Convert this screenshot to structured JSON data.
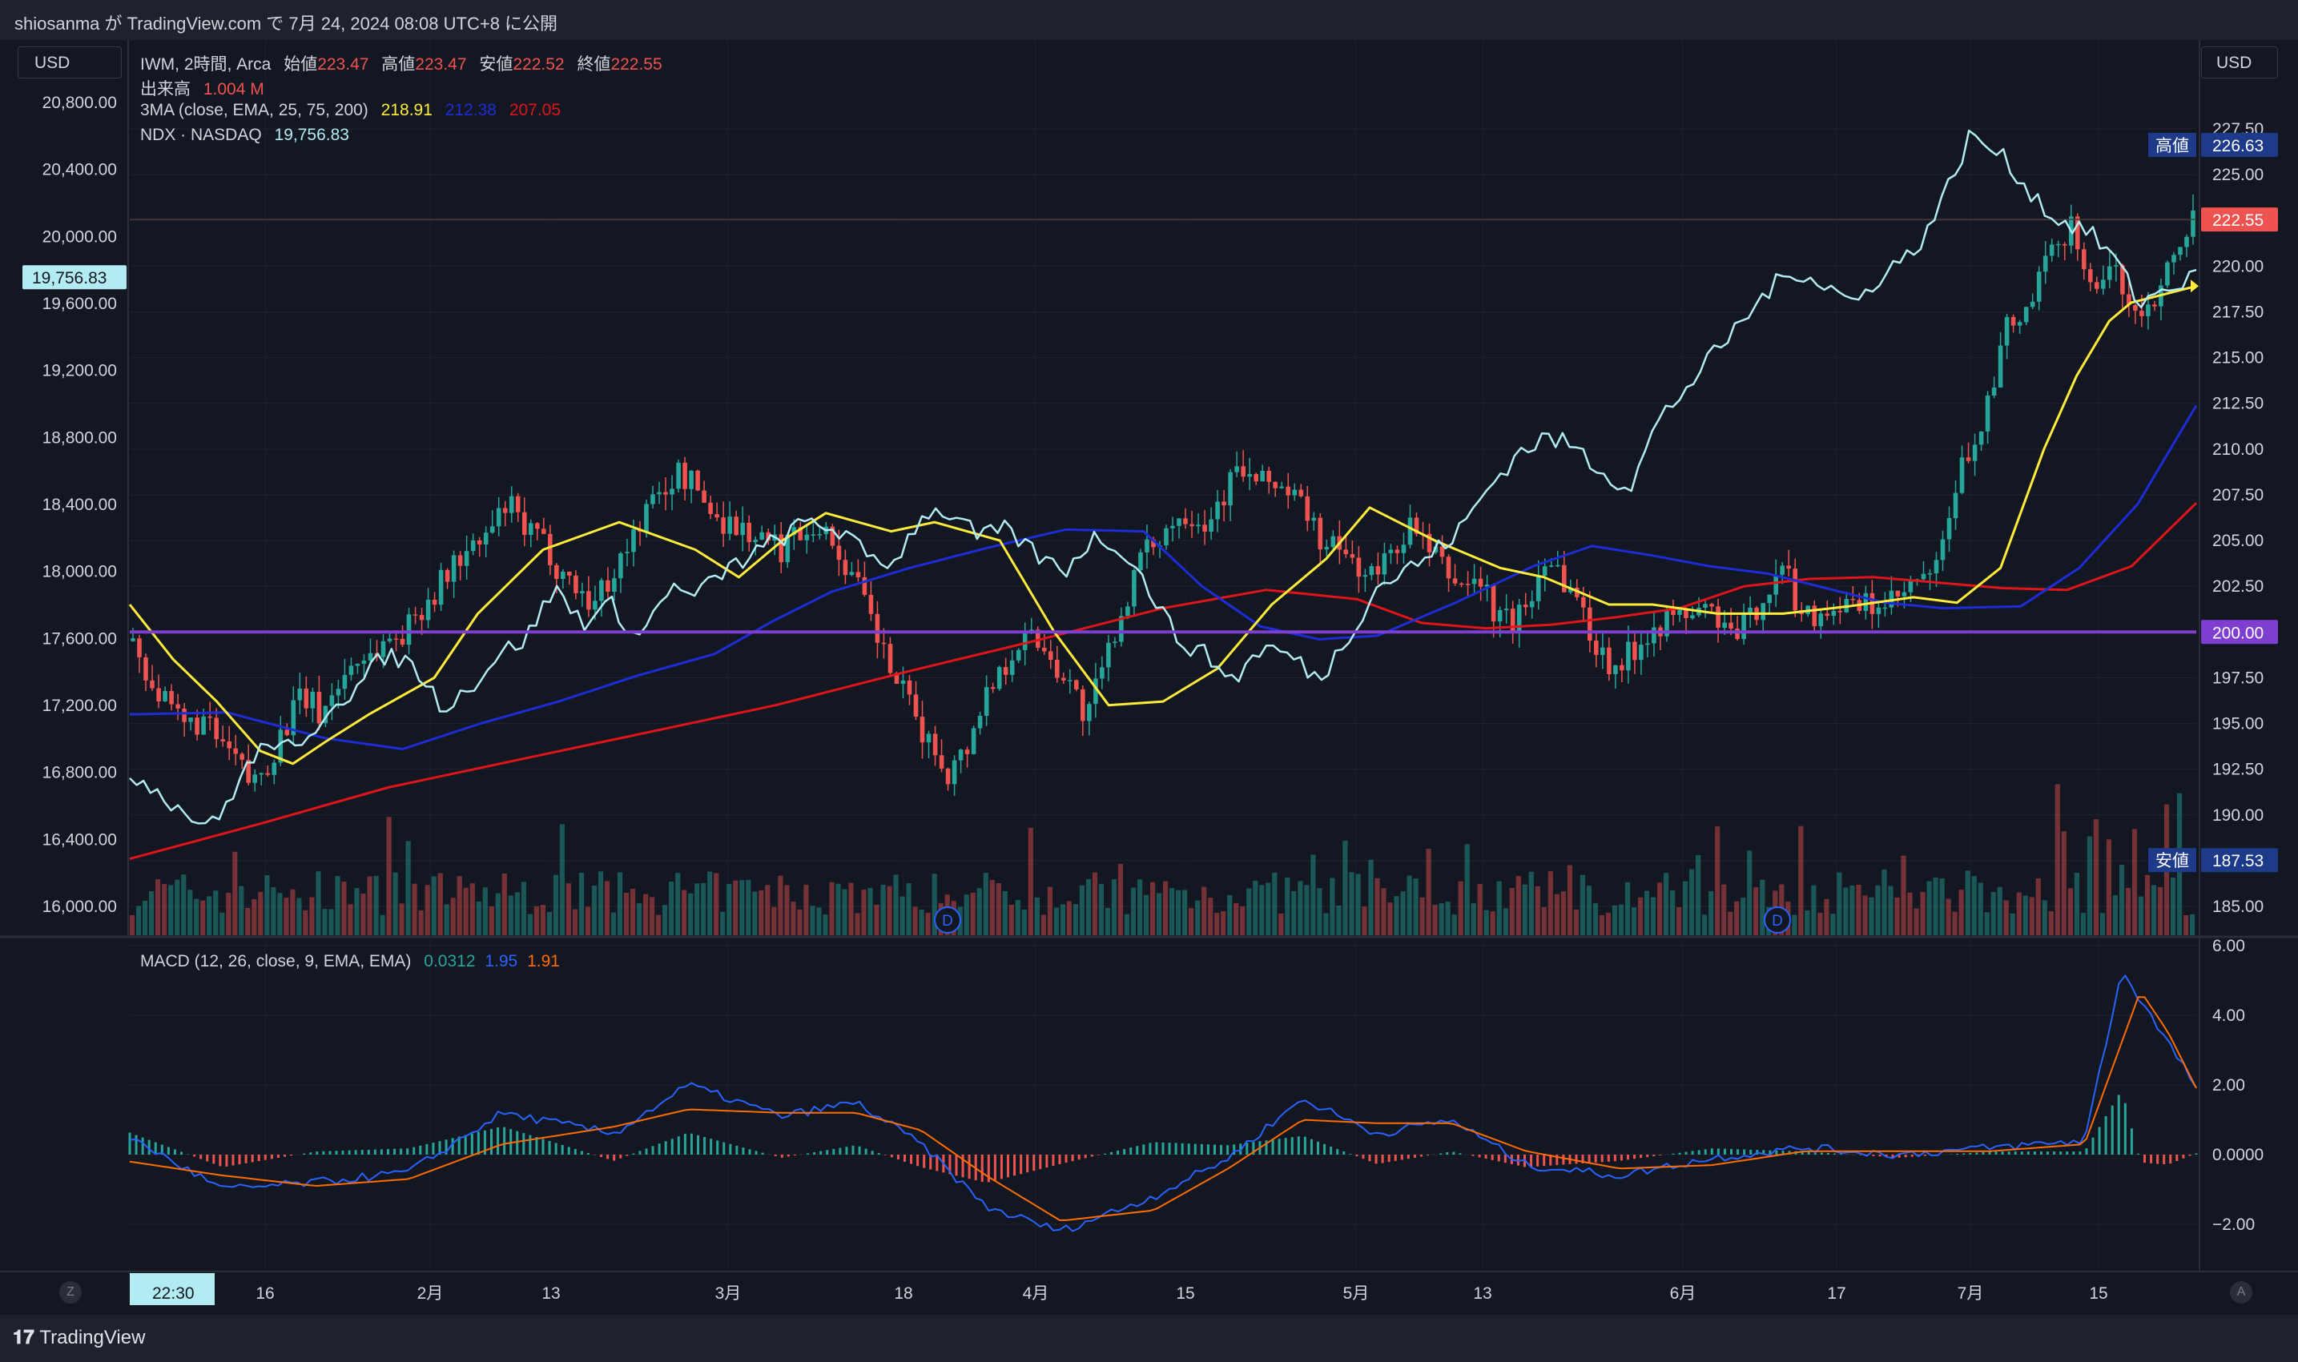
{
  "published": "shiosanma が TradingView.com で 7月 24, 2024 08:08 UTC+8 に公開",
  "currency_left": "USD",
  "currency_right": "USD",
  "legend": {
    "symbol": "IWM, 2時間, Arca",
    "open_label": "始値",
    "open": "223.47",
    "high_label": "高値",
    "high": "223.47",
    "low_label": "安値",
    "low": "222.52",
    "close_label": "終値",
    "close": "222.55",
    "volume_label": "出来高",
    "volume": "1.004 M",
    "ma_label": "3MA (close, EMA, 25, 75, 200)",
    "ma25": "218.91",
    "ma75": "212.38",
    "ma200": "207.05",
    "ndx_label": "NDX · NASDAQ",
    "ndx_value": "19,756.83",
    "macd_label": "MACD (12, 26, close, 9, EMA, EMA)",
    "macd_hist": "0.0312",
    "macd_line": "1.95",
    "macd_signal": "1.91"
  },
  "right_axis": [
    "227.50",
    "225.00",
    "222.50",
    "220.00",
    "217.50",
    "215.00",
    "212.50",
    "210.00",
    "207.50",
    "205.00",
    "202.50",
    "200.00",
    "197.50",
    "195.00",
    "192.50",
    "190.00",
    "187.50",
    "185.00"
  ],
  "left_axis": [
    "20,800.00",
    "20,400.00",
    "20,000.00",
    "19,600.00",
    "19,200.00",
    "18,800.00",
    "18,400.00",
    "18,000.00",
    "17,600.00",
    "17,200.00",
    "16,800.00",
    "16,400.00",
    "16,000.00"
  ],
  "macd_axis": [
    "6.00",
    "4.00",
    "2.00",
    "0.0000",
    "−2.00"
  ],
  "time_axis": [
    "16",
    "2月",
    "13",
    "3月",
    "18",
    "4月",
    "15",
    "5月",
    "13",
    "6月",
    "17",
    "7月",
    "15"
  ],
  "time_cursor": "22:30",
  "price_tags": {
    "high_label": "高値",
    "high_value": "226.63",
    "last": "222.55",
    "level": "200.00",
    "low_label": "安値",
    "low_value": "187.53",
    "ndx_tag": "19,756.83"
  },
  "dividend_marker": "D",
  "corner_left": "Z",
  "corner_right": "A",
  "logo": "TradingView",
  "colors": {
    "background": "#131722",
    "up": "#26a69a",
    "down": "#ef5350",
    "ma25": "#ffeb3b",
    "ma75": "#1e2cd8",
    "ma200": "#e0151b",
    "ndx": "#b2ebf2",
    "level": "#7e3fd1",
    "macd": "#2962ff",
    "signal": "#ff6d00"
  },
  "chart_data": {
    "type": "candlestick",
    "timeframe": "2H",
    "x_ticks": [
      "16",
      "2月",
      "13",
      "3月",
      "18",
      "4月",
      "15",
      "5月",
      "13",
      "6月",
      "17",
      "7月",
      "15"
    ],
    "price_ylim": [
      185.0,
      227.5
    ],
    "ndx_ylim": [
      16000,
      20800
    ],
    "macd_ylim": [
      -2.0,
      6.0
    ],
    "iwm_close_path": [
      [
        0,
        199.5
      ],
      [
        1,
        197.5
      ],
      [
        2,
        195.8
      ],
      [
        3,
        194.8
      ],
      [
        4,
        195.2
      ],
      [
        5,
        194.0
      ],
      [
        6,
        193.0
      ],
      [
        7,
        191.6
      ],
      [
        8,
        193.0
      ],
      [
        9,
        195.0
      ],
      [
        10,
        196.5
      ],
      [
        11,
        195.5
      ],
      [
        12,
        197.0
      ],
      [
        13,
        198.5
      ],
      [
        14,
        198.8
      ],
      [
        15,
        199.6
      ],
      [
        16,
        200.0
      ],
      [
        17,
        201.5
      ],
      [
        18,
        202.5
      ],
      [
        19,
        204.0
      ],
      [
        20,
        204.4
      ],
      [
        21,
        205.5
      ],
      [
        22,
        207.0
      ],
      [
        23,
        205.5
      ],
      [
        24,
        205.0
      ],
      [
        25,
        203.5
      ],
      [
        26,
        202.5
      ],
      [
        27,
        201.5
      ],
      [
        28,
        203.0
      ],
      [
        29,
        204.5
      ],
      [
        30,
        206.5
      ],
      [
        31,
        207.5
      ],
      [
        32,
        208.7
      ],
      [
        33,
        208.0
      ],
      [
        34,
        206.5
      ],
      [
        35,
        206.0
      ],
      [
        36,
        205.5
      ],
      [
        37,
        205.0
      ],
      [
        38,
        204.5
      ],
      [
        39,
        205.5
      ],
      [
        40,
        206.0
      ],
      [
        41,
        205.0
      ],
      [
        42,
        203.5
      ],
      [
        43,
        201.5
      ],
      [
        44,
        199.0
      ],
      [
        45,
        197.0
      ],
      [
        46,
        195.2
      ],
      [
        47,
        193.5
      ],
      [
        48,
        192.3
      ],
      [
        49,
        193.8
      ],
      [
        50,
        196.5
      ],
      [
        51,
        198.0
      ],
      [
        52,
        199.5
      ],
      [
        53,
        199.8
      ],
      [
        54,
        198.5
      ],
      [
        55,
        197.3
      ],
      [
        56,
        195.2
      ],
      [
        57,
        198.0
      ],
      [
        58,
        201.0
      ],
      [
        59,
        203.5
      ],
      [
        60,
        205.0
      ],
      [
        61,
        206.0
      ],
      [
        62,
        206.7
      ],
      [
        63,
        206.0
      ],
      [
        64,
        207.5
      ],
      [
        65,
        209.0
      ],
      [
        66,
        208.0
      ],
      [
        67,
        208.3
      ],
      [
        68,
        207.5
      ],
      [
        69,
        206.5
      ],
      [
        70,
        204.5
      ],
      [
        71,
        204.5
      ],
      [
        72,
        203.5
      ],
      [
        73,
        203.0
      ],
      [
        74,
        204.5
      ],
      [
        75,
        205.8
      ],
      [
        76,
        204.5
      ],
      [
        77,
        203.5
      ],
      [
        78,
        202.5
      ],
      [
        79,
        203.0
      ],
      [
        80,
        201.0
      ],
      [
        81,
        200.5
      ],
      [
        82,
        201.5
      ],
      [
        83,
        204.5
      ],
      [
        84,
        203.0
      ],
      [
        85,
        201.5
      ],
      [
        86,
        199.0
      ],
      [
        87,
        198.2
      ],
      [
        88,
        198.8
      ],
      [
        89,
        200.2
      ],
      [
        90,
        200.6
      ],
      [
        91,
        200.8
      ],
      [
        92,
        201.3
      ],
      [
        93,
        200.9
      ],
      [
        94,
        199.5
      ],
      [
        95,
        200.8
      ],
      [
        96,
        202.3
      ],
      [
        97,
        203.5
      ],
      [
        98,
        201.0
      ],
      [
        99,
        201.0
      ],
      [
        100,
        201.5
      ],
      [
        101,
        201.2
      ],
      [
        102,
        201.5
      ],
      [
        103,
        201.3
      ],
      [
        104,
        202.0
      ],
      [
        105,
        202.8
      ],
      [
        106,
        203.3
      ],
      [
        107,
        207.8
      ],
      [
        108,
        210.3
      ],
      [
        109,
        212.4
      ],
      [
        110,
        216.5
      ],
      [
        111,
        217.0
      ],
      [
        112,
        219.2
      ],
      [
        113,
        221.2
      ],
      [
        114,
        222.5
      ],
      [
        115,
        218.5
      ],
      [
        116,
        220.0
      ],
      [
        117,
        218.6
      ],
      [
        118,
        217.0
      ],
      [
        119,
        219.0
      ],
      [
        120,
        221.5
      ],
      [
        121,
        222.55
      ]
    ],
    "ma25_path": [
      [
        0,
        201.5
      ],
      [
        4,
        198.5
      ],
      [
        8,
        196.2
      ],
      [
        12,
        193.5
      ],
      [
        15,
        192.8
      ],
      [
        18,
        194.0
      ],
      [
        22,
        195.5
      ],
      [
        28,
        197.5
      ],
      [
        32,
        201.0
      ],
      [
        38,
        204.5
      ],
      [
        45,
        206.0
      ],
      [
        52,
        204.5
      ],
      [
        56,
        203.0
      ],
      [
        60,
        205.0
      ],
      [
        64,
        206.5
      ],
      [
        70,
        205.5
      ],
      [
        74,
        206.0
      ],
      [
        80,
        205.0
      ],
      [
        85,
        200.0
      ],
      [
        90,
        196.0
      ],
      [
        95,
        196.2
      ],
      [
        100,
        198.0
      ],
      [
        105,
        201.5
      ],
      [
        110,
        204.0
      ],
      [
        114,
        206.8
      ],
      [
        120,
        205.0
      ],
      [
        126,
        203.5
      ],
      [
        130,
        203.0
      ],
      [
        136,
        201.5
      ],
      [
        140,
        201.5
      ],
      [
        146,
        201.0
      ],
      [
        152,
        201.0
      ],
      [
        158,
        201.4
      ],
      [
        164,
        201.9
      ],
      [
        168,
        201.6
      ],
      [
        172,
        203.5
      ],
      [
        176,
        210.0
      ],
      [
        179,
        214.0
      ],
      [
        182,
        217.0
      ],
      [
        184,
        218.0
      ],
      [
        186,
        218.3
      ],
      [
        190,
        218.91
      ]
    ],
    "ma75_path": [
      [
        0,
        195.5
      ],
      [
        10,
        195.6
      ],
      [
        20,
        194.2
      ],
      [
        28,
        193.6
      ],
      [
        36,
        195.0
      ],
      [
        44,
        196.2
      ],
      [
        52,
        197.6
      ],
      [
        60,
        198.8
      ],
      [
        66,
        200.6
      ],
      [
        72,
        202.2
      ],
      [
        80,
        203.5
      ],
      [
        88,
        204.6
      ],
      [
        96,
        205.6
      ],
      [
        104,
        205.5
      ],
      [
        110,
        202.5
      ],
      [
        116,
        200.3
      ],
      [
        122,
        199.6
      ],
      [
        128,
        199.8
      ],
      [
        136,
        201.6
      ],
      [
        144,
        203.6
      ],
      [
        150,
        204.7
      ],
      [
        156,
        204.2
      ],
      [
        162,
        203.6
      ],
      [
        168,
        203.2
      ],
      [
        174,
        202.4
      ],
      [
        180,
        201.6
      ],
      [
        186,
        201.3
      ],
      [
        194,
        201.4
      ],
      [
        200,
        203.5
      ],
      [
        206,
        207.0
      ],
      [
        212,
        212.38
      ]
    ],
    "ma200_path": [
      [
        0,
        187.6
      ],
      [
        20,
        189.5
      ],
      [
        40,
        191.5
      ],
      [
        60,
        193.0
      ],
      [
        80,
        194.5
      ],
      [
        100,
        196.0
      ],
      [
        120,
        197.8
      ],
      [
        140,
        199.5
      ],
      [
        160,
        201.3
      ],
      [
        176,
        202.3
      ],
      [
        190,
        201.8
      ],
      [
        200,
        200.5
      ],
      [
        210,
        200.2
      ],
      [
        220,
        200.4
      ],
      [
        230,
        200.8
      ],
      [
        240,
        201.3
      ],
      [
        250,
        202.5
      ],
      [
        260,
        202.9
      ],
      [
        270,
        203.0
      ],
      [
        280,
        202.7
      ],
      [
        290,
        202.4
      ],
      [
        300,
        202.3
      ],
      [
        310,
        203.6
      ],
      [
        320,
        207.05
      ]
    ],
    "ndx_path": [
      [
        0,
        16800
      ],
      [
        4,
        16700
      ],
      [
        8,
        16550
      ],
      [
        12,
        16480
      ],
      [
        16,
        16800
      ],
      [
        20,
        17000
      ],
      [
        24,
        16900
      ],
      [
        28,
        17200
      ],
      [
        32,
        17300
      ],
      [
        36,
        17500
      ],
      [
        40,
        17450
      ],
      [
        44,
        17200
      ],
      [
        48,
        17300
      ],
      [
        52,
        17500
      ],
      [
        56,
        17600
      ],
      [
        60,
        17900
      ],
      [
        64,
        17700
      ],
      [
        68,
        17800
      ],
      [
        72,
        17600
      ],
      [
        76,
        17900
      ],
      [
        80,
        17850
      ],
      [
        84,
        18000
      ],
      [
        88,
        18100
      ],
      [
        92,
        18200
      ],
      [
        96,
        18300
      ],
      [
        100,
        18250
      ],
      [
        104,
        18100
      ],
      [
        108,
        18050
      ],
      [
        112,
        18350
      ],
      [
        116,
        18350
      ],
      [
        120,
        18200
      ],
      [
        124,
        18250
      ],
      [
        128,
        18100
      ],
      [
        132,
        18000
      ],
      [
        136,
        18200
      ],
      [
        140,
        18150
      ],
      [
        144,
        17900
      ],
      [
        148,
        17600
      ],
      [
        152,
        17500
      ],
      [
        156,
        17350
      ],
      [
        160,
        17550
      ],
      [
        164,
        17500
      ],
      [
        168,
        17350
      ],
      [
        172,
        17600
      ],
      [
        176,
        17900
      ],
      [
        180,
        18000
      ],
      [
        184,
        18100
      ],
      [
        188,
        18250
      ],
      [
        192,
        18500
      ],
      [
        196,
        18700
      ],
      [
        200,
        18800
      ],
      [
        204,
        18750
      ],
      [
        208,
        18600
      ],
      [
        212,
        18500
      ],
      [
        216,
        18900
      ],
      [
        220,
        19100
      ],
      [
        224,
        19300
      ],
      [
        228,
        19500
      ],
      [
        232,
        19700
      ],
      [
        236,
        19800
      ],
      [
        240,
        19700
      ],
      [
        244,
        19600
      ],
      [
        248,
        19800
      ],
      [
        252,
        19900
      ],
      [
        256,
        20200
      ],
      [
        260,
        20600
      ],
      [
        264,
        20500
      ],
      [
        268,
        20300
      ],
      [
        272,
        20100
      ],
      [
        276,
        20050
      ],
      [
        280,
        19900
      ],
      [
        284,
        19600
      ],
      [
        288,
        19700
      ],
      [
        292,
        19756.83
      ]
    ],
    "macd_summary": {
      "start": 0.5,
      "trough": -2.2,
      "peak": 5.3,
      "end_macd": 1.95,
      "end_signal": 1.91,
      "end_hist": 0.0312
    },
    "horizontal_level": 200.0
  }
}
